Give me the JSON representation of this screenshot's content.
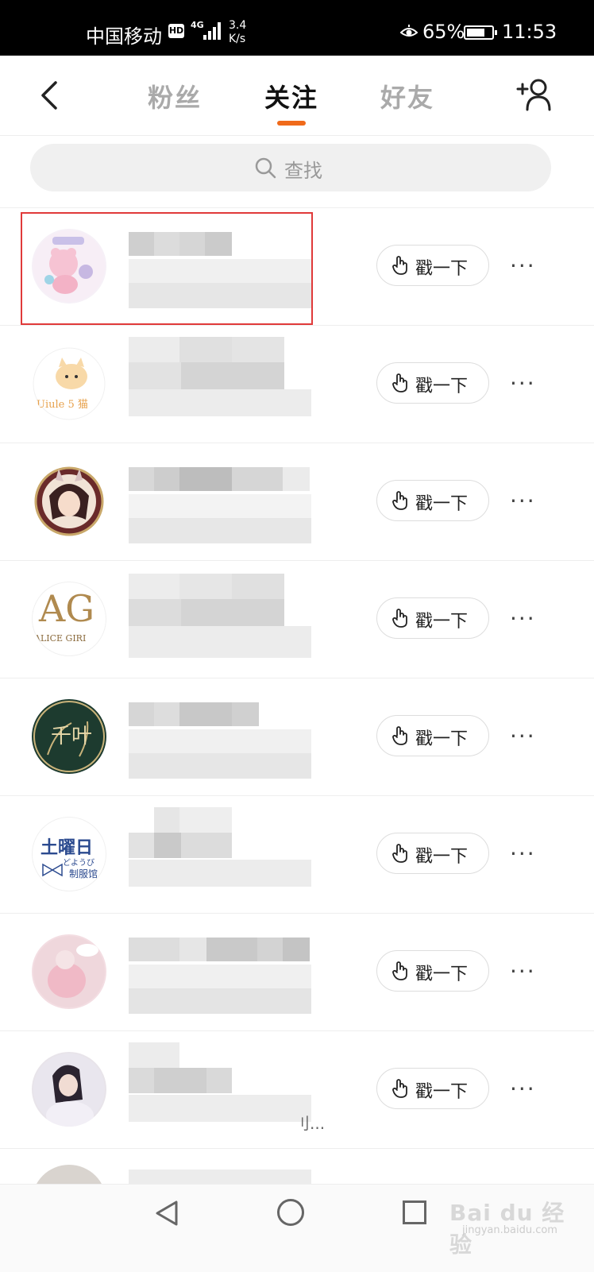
{
  "status_bar": {
    "carrier": "中国移动",
    "hd": "HD",
    "network": "4G",
    "speed_value": "3.4",
    "speed_unit": "K/s",
    "battery_percent": "65%",
    "battery_level": 0.65,
    "time": "11:53"
  },
  "header": {
    "tabs": [
      {
        "label": "粉丝",
        "active": false
      },
      {
        "label": "关注",
        "active": true
      },
      {
        "label": "好友",
        "active": false
      }
    ],
    "accent_color": "#f06a1a"
  },
  "search": {
    "placeholder": "查找"
  },
  "list": {
    "poke_label": "戳一下",
    "more_label": "···",
    "rows": [
      {
        "avatar": "pink-cartoon-avatar",
        "highlighted": true
      },
      {
        "avatar": "cat-logo-avatar"
      },
      {
        "avatar": "anime-girl-avatar"
      },
      {
        "avatar": "alice-girl-logo-avatar"
      },
      {
        "avatar": "green-emblem-avatar"
      },
      {
        "avatar": "text-logo-avatar"
      },
      {
        "avatar": "pink-doll-avatar"
      },
      {
        "avatar": "girl-photo-avatar",
        "truncated_text": "刂..."
      }
    ],
    "avatar_texts": {
      "cat_logo": "Uiule 5 猫",
      "alice": "AG",
      "alice_sub": "ALICE GIRI",
      "emblem": "千叶",
      "text_logo_main": "土曜日",
      "text_logo_sub": "どようび",
      "text_logo_sub2": "制服馆"
    },
    "highlight_color": "#e03a3a"
  },
  "watermark": {
    "text": "Bai du 经验",
    "sub": "jingyan.baidu.com"
  }
}
